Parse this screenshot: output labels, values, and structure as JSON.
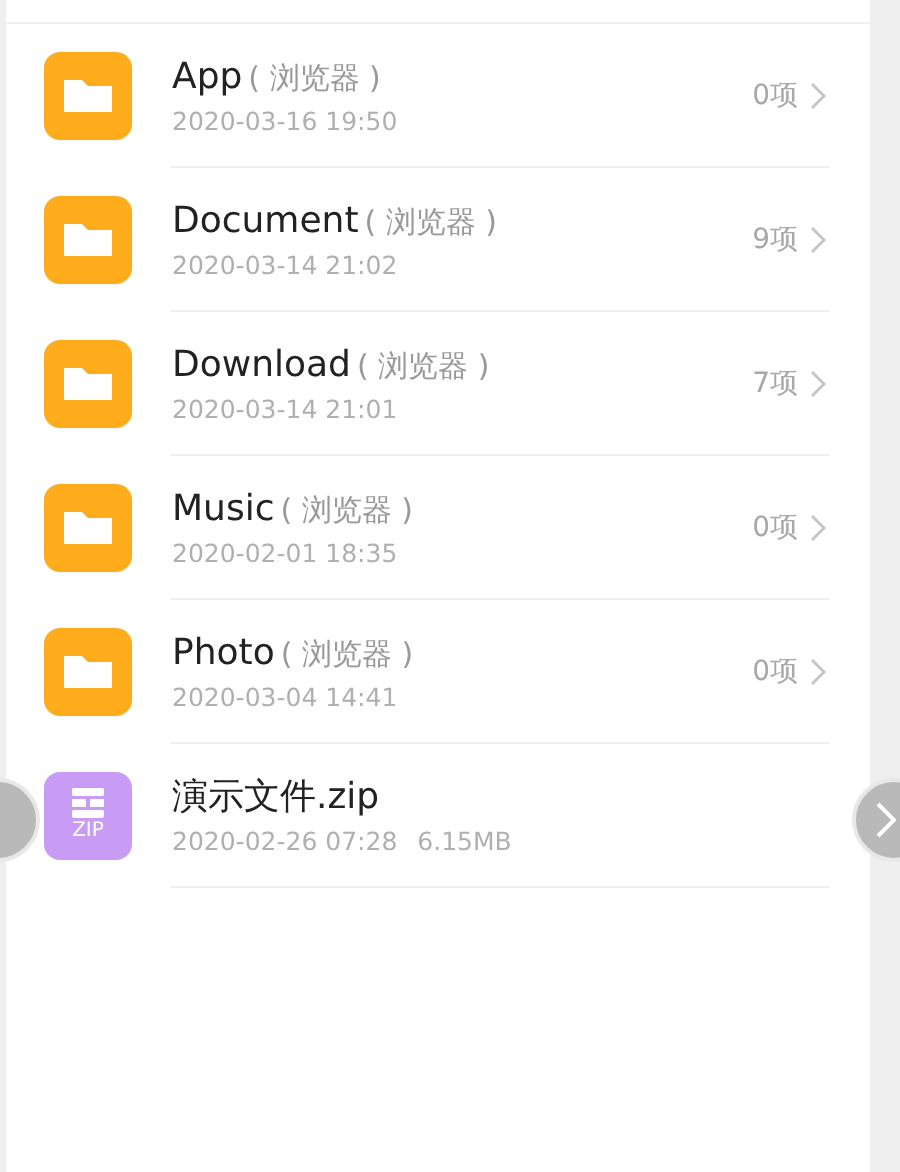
{
  "items": [
    {
      "kind": "folder",
      "name": "App",
      "source": "( 浏览器 )",
      "date": "2020-03-16 19:50",
      "count": "0项"
    },
    {
      "kind": "folder",
      "name": "Document",
      "source": "( 浏览器 )",
      "date": "2020-03-14 21:02",
      "count": "9项"
    },
    {
      "kind": "folder",
      "name": "Download",
      "source": "( 浏览器 )",
      "date": "2020-03-14 21:01",
      "count": "7项"
    },
    {
      "kind": "folder",
      "name": "Music",
      "source": "( 浏览器 )",
      "date": "2020-02-01 18:35",
      "count": "0项"
    },
    {
      "kind": "folder",
      "name": "Photo",
      "source": "( 浏览器 )",
      "date": "2020-03-04 14:41",
      "count": "0项"
    },
    {
      "kind": "zip",
      "name": "演示文件.zip",
      "badge": "ZIP",
      "date": "2020-02-26 07:28",
      "size": "6.15MB"
    }
  ]
}
